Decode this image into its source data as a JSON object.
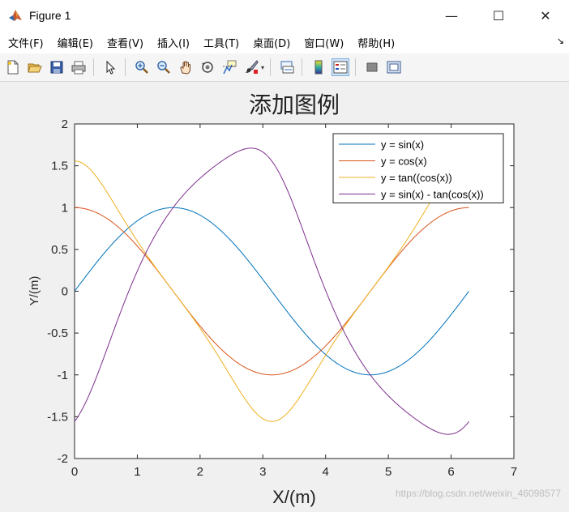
{
  "window": {
    "title": "Figure 1",
    "controls": {
      "minimize": "—",
      "maximize": "☐",
      "close": "✕"
    }
  },
  "menubar": {
    "items": [
      "文件(F)",
      "编辑(E)",
      "查看(V)",
      "插入(I)",
      "工具(T)",
      "桌面(D)",
      "窗口(W)",
      "帮助(H)"
    ],
    "overflow": "↘"
  },
  "toolbar": {
    "buttons": [
      "new-figure-icon",
      "open-file-icon",
      "save-icon",
      "print-icon",
      "edit-plot-arrow-icon",
      "zoom-in-icon",
      "zoom-out-icon",
      "pan-hand-icon",
      "rotate-3d-icon",
      "data-cursor-icon",
      "brush-icon",
      "link-plot-icon",
      "colorbar-icon",
      "legend-icon",
      "hide-plot-tools-icon",
      "show-plot-tools-icon"
    ],
    "active": "legend-icon"
  },
  "watermark": "https://blog.csdn.net/weixin_46098577",
  "chart_data": {
    "type": "line",
    "title": "添加图例",
    "xlabel": "X/(m)",
    "ylabel": "Y/(m)",
    "xlim": [
      0,
      7
    ],
    "ylim": [
      -2,
      2
    ],
    "xticks": [
      "0",
      "1",
      "2",
      "3",
      "4",
      "5",
      "6",
      "7"
    ],
    "yticks": [
      "-2",
      "-1.5",
      "-1",
      "-0.5",
      "0",
      "0.5",
      "1",
      "1.5",
      "2"
    ],
    "grid": false,
    "legend_position": "top-right",
    "x_range": [
      0,
      6.2832
    ],
    "series": [
      {
        "name": "y = sin(x)",
        "color": "#0072bd",
        "x": [
          0,
          0.2618,
          0.5236,
          0.7854,
          1.0472,
          1.309,
          1.5708,
          1.8326,
          2.0944,
          2.3562,
          2.618,
          2.8798,
          3.1416,
          3.4034,
          3.6652,
          3.927,
          4.1888,
          4.4506,
          4.7124,
          4.9742,
          5.236,
          5.4978,
          5.7596,
          6.0214,
          6.2832
        ],
        "y": [
          0,
          0.2588,
          0.5,
          0.7071,
          0.866,
          0.9659,
          1,
          0.9659,
          0.866,
          0.7071,
          0.5,
          0.2588,
          0,
          -0.2588,
          -0.5,
          -0.7071,
          -0.866,
          -0.9659,
          -1,
          -0.9659,
          -0.866,
          -0.7071,
          -0.5,
          -0.2588,
          0
        ]
      },
      {
        "name": "y = cos(x)",
        "color": "#d95319",
        "x": [
          0,
          0.2618,
          0.5236,
          0.7854,
          1.0472,
          1.309,
          1.5708,
          1.8326,
          2.0944,
          2.3562,
          2.618,
          2.8798,
          3.1416,
          3.4034,
          3.6652,
          3.927,
          4.1888,
          4.4506,
          4.7124,
          4.9742,
          5.236,
          5.4978,
          5.7596,
          6.0214,
          6.2832
        ],
        "y": [
          1,
          0.9659,
          0.866,
          0.7071,
          0.5,
          0.2588,
          0,
          -0.2588,
          -0.5,
          -0.7071,
          -0.866,
          -0.9659,
          -1,
          -0.9659,
          -0.866,
          -0.7071,
          -0.5,
          -0.2588,
          0,
          0.2588,
          0.5,
          0.7071,
          0.866,
          0.9659,
          1
        ]
      },
      {
        "name": "y = tan((cos(x))",
        "color": "#edb120",
        "x": [
          0,
          0.2618,
          0.5236,
          0.7854,
          1.0472,
          1.309,
          1.5708,
          1.8326,
          2.0944,
          2.3562,
          2.618,
          2.8798,
          3.1416,
          3.4034,
          3.6652,
          3.927,
          4.1888,
          4.4506,
          4.7124,
          4.9742,
          5.236,
          5.4978,
          5.7596,
          6.0214,
          6.2832
        ],
        "y": [
          1.5574,
          1.4518,
          1.1778,
          0.8545,
          0.5463,
          0.2647,
          0,
          -0.2647,
          -0.5463,
          -0.8545,
          -1.1778,
          -1.4518,
          -1.5574,
          -1.4518,
          -1.1778,
          -0.8545,
          -0.5463,
          -0.2647,
          0,
          0.2647,
          0.5463,
          0.8545,
          1.1778,
          1.4518,
          1.5574
        ]
      },
      {
        "name": "y = sin(x) - tan(cos(x))",
        "color": "#7e2f8e",
        "x": [
          0,
          0.2618,
          0.5236,
          0.7854,
          1.0472,
          1.309,
          1.5708,
          1.8326,
          2.0944,
          2.3562,
          2.618,
          2.8798,
          3.1416,
          3.4034,
          3.6652,
          3.927,
          4.1888,
          4.4506,
          4.7124,
          4.9742,
          5.236,
          5.4978,
          5.7596,
          6.0214,
          6.2832
        ],
        "y": [
          -1.5574,
          -1.193,
          -0.6778,
          -0.1474,
          0.3197,
          0.7012,
          1,
          1.2306,
          1.4123,
          1.5616,
          1.6778,
          1.7106,
          1.5574,
          1.193,
          0.6778,
          0.1474,
          -0.3197,
          -0.7012,
          -1,
          -1.2306,
          -1.4123,
          -1.5616,
          -1.6778,
          -1.7106,
          -1.5574
        ]
      }
    ]
  }
}
